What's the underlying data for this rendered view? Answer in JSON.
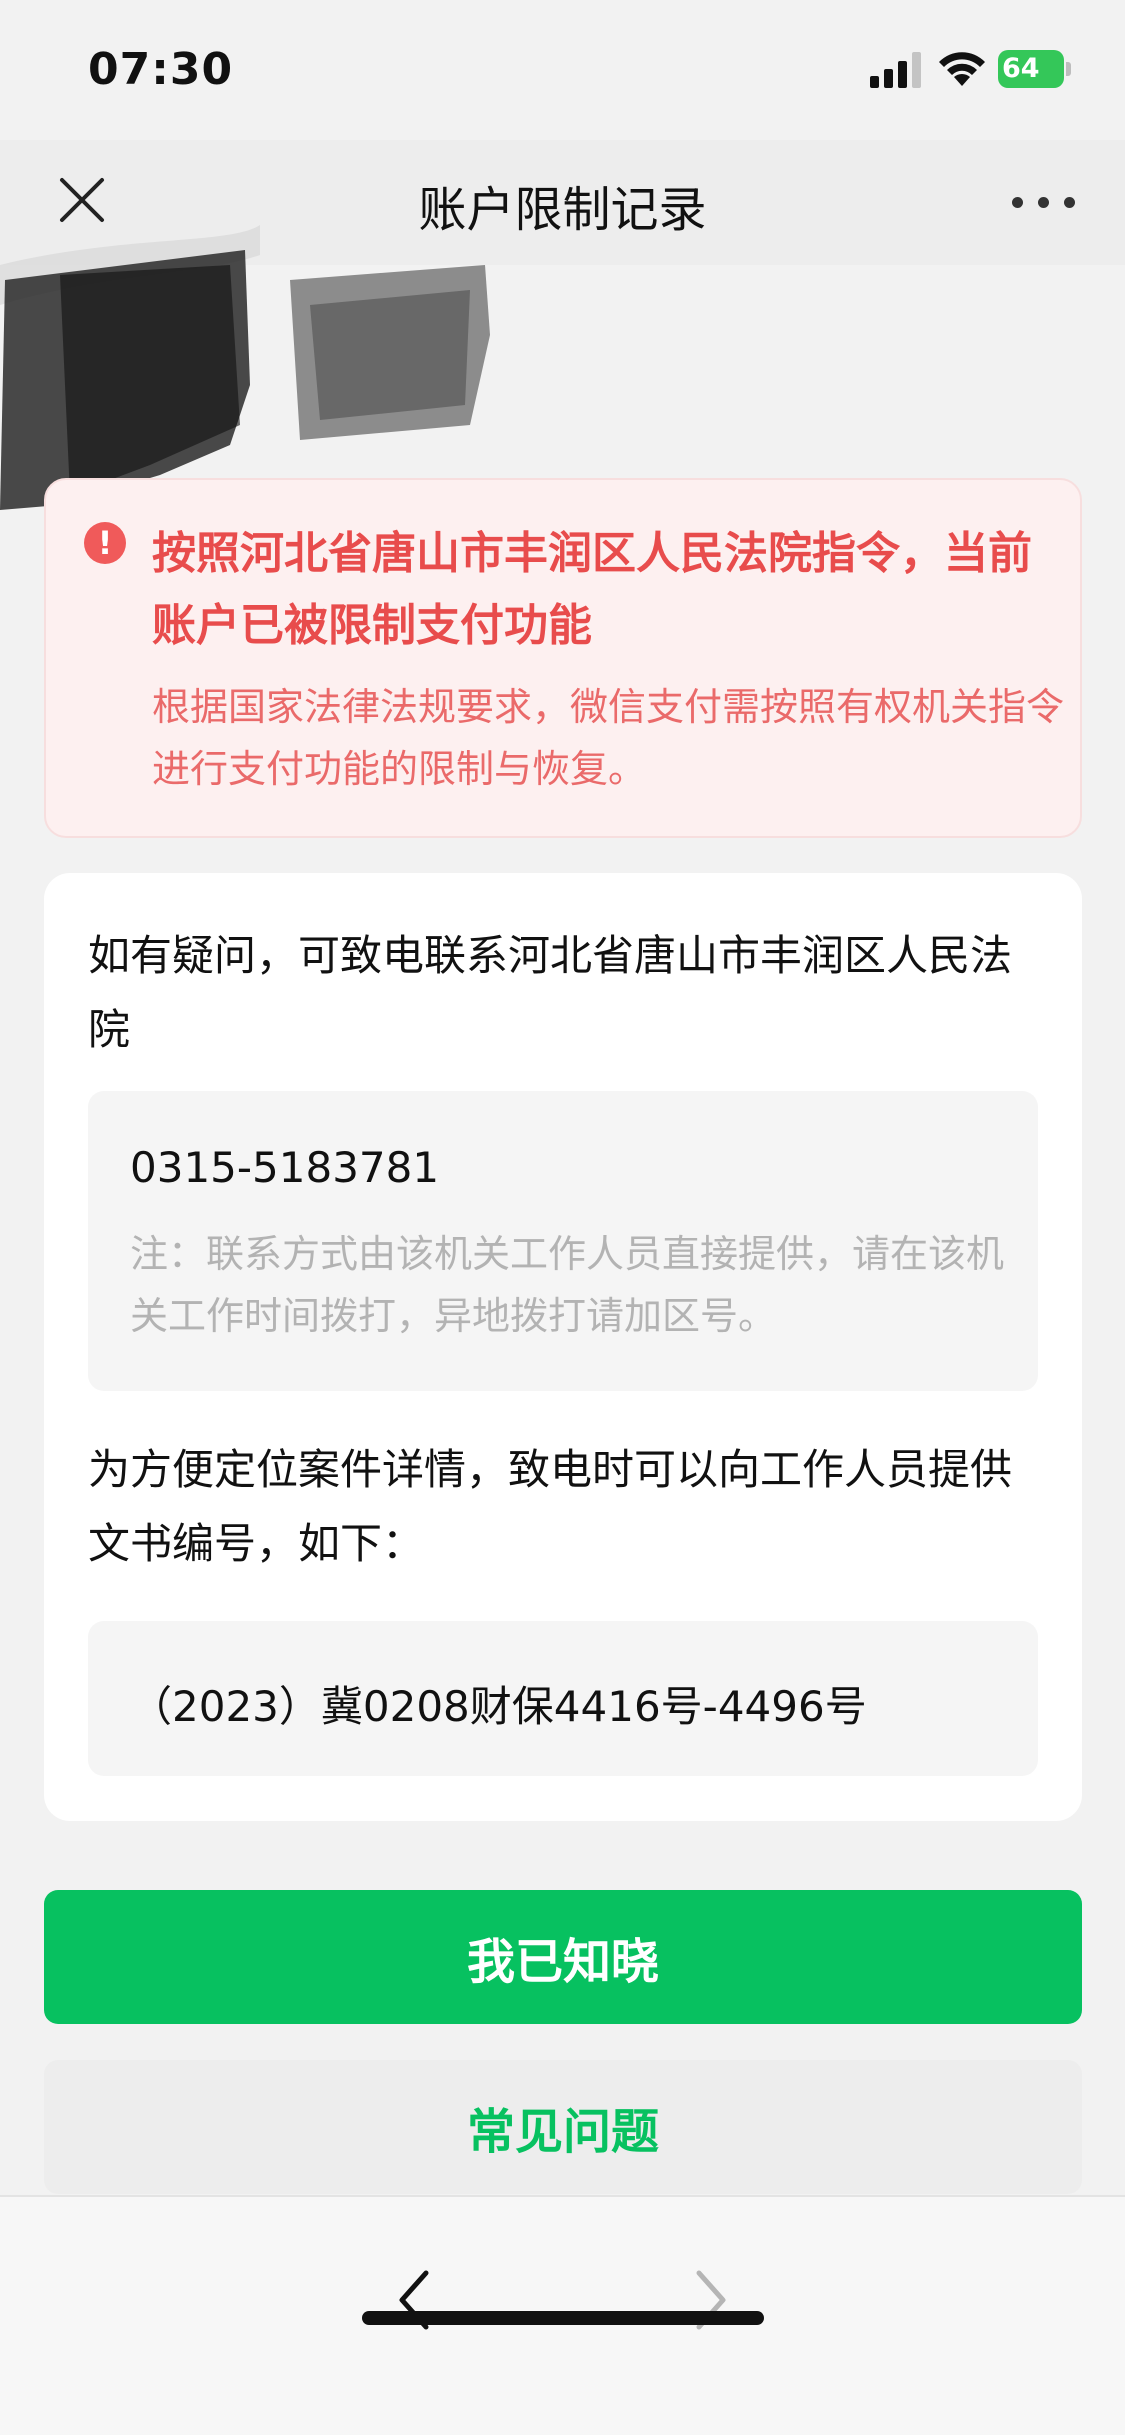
{
  "status_bar": {
    "time": "07:30",
    "battery_level": "64",
    "battery_color": "#34c759"
  },
  "nav": {
    "title": "账户限制记录",
    "close_icon": "close-icon",
    "more_icon": "more-icon"
  },
  "warning": {
    "icon": "alert-circle-icon",
    "title": "按照河北省唐山市丰润区人民法院指令，当前账户已被限制支付功能",
    "description": "根据国家法律法规要求，微信支付需按照有权机关指令进行支付功能的限制与恢复。",
    "color": "#e84c4c"
  },
  "info": {
    "contact_text": "如有疑问，可致电联系河北省唐山市丰润区人民法院",
    "phone_number": "0315-5183781",
    "phone_note": "注：联系方式由该机关工作人员直接提供，请在该机关工作时间拨打，异地拨打请加区号。",
    "doc_text": "为方便定位案件详情，致电时可以向工作人员提供文书编号，如下：",
    "doc_number": "（2023）冀0208财保4416号-4496号"
  },
  "buttons": {
    "acknowledge_label": "我已知晓",
    "faq_label": "常见问题",
    "accent_color": "#07c160"
  },
  "toolbar": {
    "back_icon": "chevron-left-icon",
    "forward_icon": "chevron-right-icon"
  }
}
